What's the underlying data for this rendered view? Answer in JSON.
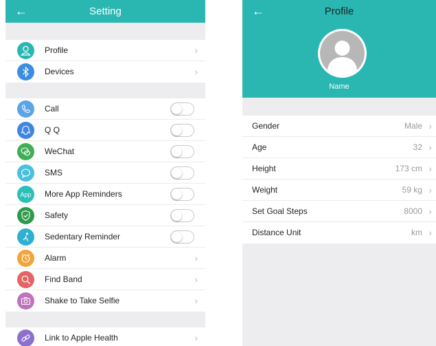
{
  "setting": {
    "title": "Setting",
    "groups": [
      [
        {
          "label": "Profile",
          "icon": "person-icon",
          "color": "#2ab7b2",
          "control": "chevron"
        },
        {
          "label": "Devices",
          "icon": "bluetooth-icon",
          "color": "#3b8de0",
          "control": "chevron"
        }
      ],
      [
        {
          "label": "Call",
          "icon": "phone-icon",
          "color": "#5aa4e8",
          "control": "toggle"
        },
        {
          "label": "Q Q",
          "icon": "qq-icon",
          "color": "#3f86e0",
          "control": "toggle"
        },
        {
          "label": "WeChat",
          "icon": "wechat-icon",
          "color": "#3fae57",
          "control": "toggle"
        },
        {
          "label": "SMS",
          "icon": "sms-icon",
          "color": "#48c0de",
          "control": "toggle"
        },
        {
          "label": "More App Reminders",
          "icon": "app-icon",
          "icon_text": "App",
          "color": "#2cbfb8",
          "control": "toggle"
        },
        {
          "label": "Safety",
          "icon": "shield-icon",
          "color": "#2f9a4b",
          "control": "toggle"
        },
        {
          "label": "Sedentary Reminder",
          "icon": "sedentary-icon",
          "color": "#2fb0d2",
          "control": "toggle"
        },
        {
          "label": "Alarm",
          "icon": "alarm-clock-icon",
          "color": "#f1a53a",
          "control": "chevron"
        },
        {
          "label": "Find Band",
          "icon": "search-icon",
          "color": "#e56467",
          "control": "chevron"
        },
        {
          "label": "Shake to Take Selfie",
          "icon": "camera-icon",
          "color": "#c073bd",
          "control": "chevron"
        }
      ],
      [
        {
          "label": "Link to Apple Health",
          "icon": "link-icon",
          "color": "#8c6fcf",
          "control": "chevron"
        }
      ]
    ]
  },
  "profile": {
    "title": "Profile",
    "name_label": "Name",
    "fields": [
      {
        "label": "Gender",
        "value": "Male"
      },
      {
        "label": "Age",
        "value": "32"
      },
      {
        "label": "Height",
        "value": "173 cm"
      },
      {
        "label": "Weight",
        "value": "59 kg"
      },
      {
        "label": "Set Goal Steps",
        "value": "8000"
      },
      {
        "label": "Distance Unit",
        "value": "km"
      }
    ]
  },
  "colors": {
    "accent": "#2ab7b2",
    "background": "#ededf0"
  }
}
